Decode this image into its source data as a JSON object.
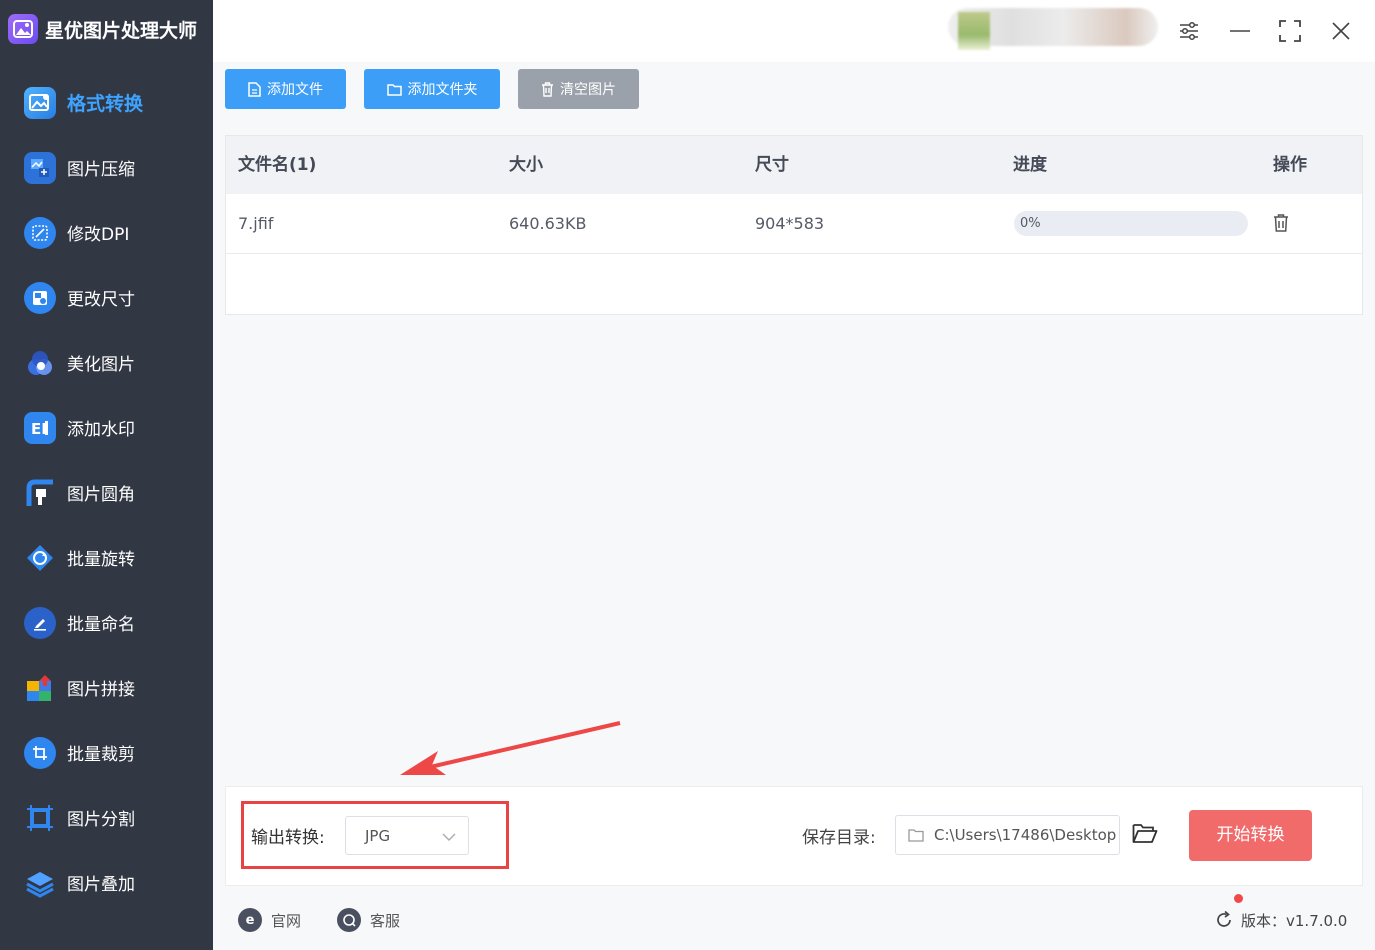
{
  "app": {
    "title": "星优图片处理大师",
    "accent_color": "#3d9ef7",
    "sidebar_bg": "#323744"
  },
  "sidebar": {
    "items": [
      {
        "label": "格式转换",
        "icon": "image-convert-icon",
        "active": true
      },
      {
        "label": "图片压缩",
        "icon": "image-compress-icon"
      },
      {
        "label": "修改DPI",
        "icon": "dpi-icon"
      },
      {
        "label": "更改尺寸",
        "icon": "resize-icon"
      },
      {
        "label": "美化图片",
        "icon": "beautify-icon"
      },
      {
        "label": "添加水印",
        "icon": "watermark-icon"
      },
      {
        "label": "图片圆角",
        "icon": "rounded-corner-icon"
      },
      {
        "label": "批量旋转",
        "icon": "rotate-icon"
      },
      {
        "label": "批量命名",
        "icon": "rename-icon"
      },
      {
        "label": "图片拼接",
        "icon": "puzzle-icon"
      },
      {
        "label": "批量裁剪",
        "icon": "crop-icon"
      },
      {
        "label": "图片分割",
        "icon": "split-icon"
      },
      {
        "label": "图片叠加",
        "icon": "layers-icon"
      }
    ]
  },
  "toolbar": {
    "add_file": "添加文件",
    "add_folder": "添加文件夹",
    "clear_images": "清空图片"
  },
  "table": {
    "columns": [
      "文件名(1)",
      "大小",
      "尺寸",
      "进度",
      "操作"
    ],
    "rows": [
      {
        "name": "7.jfif",
        "size": "640.63KB",
        "dimensions": "904*583",
        "progress_text": "0%",
        "progress": 0
      }
    ]
  },
  "bottom": {
    "output_label": "输出转换:",
    "output_format": "JPG",
    "save_label": "保存目录:",
    "save_path": "C:\\Users\\17486\\Desktop",
    "start_button": "开始转换"
  },
  "footer": {
    "website": "官网",
    "support": "客服",
    "version": "版本：v1.7.0.0"
  }
}
